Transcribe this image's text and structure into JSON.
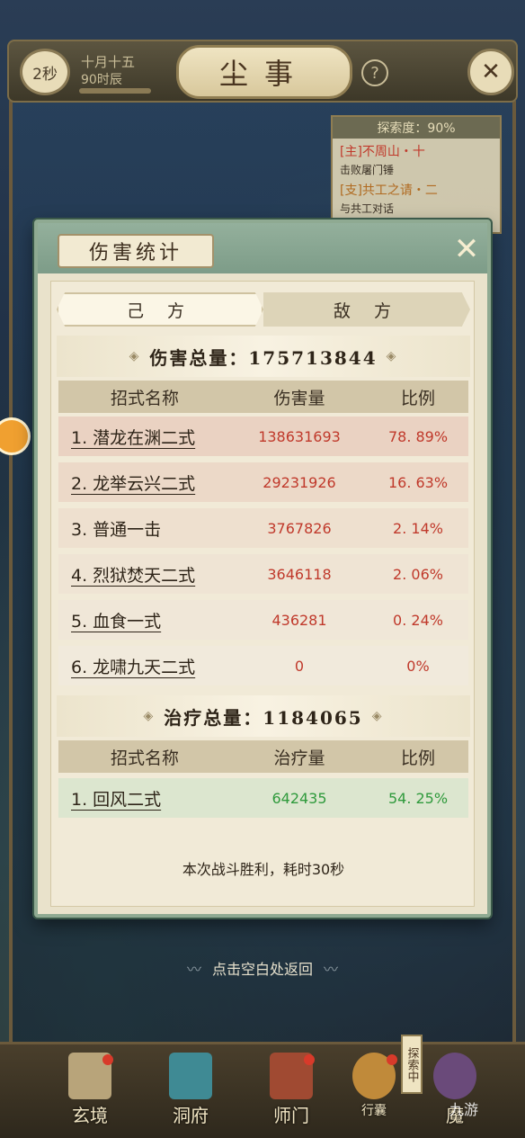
{
  "topbar": {
    "timer": "2秒",
    "date": "十月十五",
    "time_of_day": "90时辰",
    "title": "尘事",
    "help": "?",
    "map_icon": "crossed-swords-icon"
  },
  "quest": {
    "explore": "探索度：90%",
    "main_title": "[主]不周山・十",
    "main_desc": "击败屠门锤",
    "side_title": "[支]共工之请・二",
    "side_desc": "与共工对话"
  },
  "modal": {
    "title": "伤害统计",
    "tabs": [
      "己 方",
      "敌 方"
    ],
    "damage_total_label": "伤害总量：175713844",
    "damage_headers": [
      "招式名称",
      "伤害量",
      "比例"
    ],
    "damage_rows": [
      {
        "name": "1. 潜龙在渊二式",
        "value": "138631693",
        "pct": "78. 89%"
      },
      {
        "name": "2. 龙举云兴二式",
        "value": "29231926",
        "pct": "16. 63%"
      },
      {
        "name": "3. 普通一击",
        "value": "3767826",
        "pct": "2. 14%"
      },
      {
        "name": "4. 烈狱焚天二式",
        "value": "3646118",
        "pct": "2. 06%"
      },
      {
        "name": "5. 血食一式",
        "value": "436281",
        "pct": "0. 24%"
      },
      {
        "name": "6. 龙啸九天二式",
        "value": "0",
        "pct": "0%"
      }
    ],
    "heal_total_label": "治疗总量：1184065",
    "heal_headers": [
      "招式名称",
      "治疗量",
      "比例"
    ],
    "heal_rows": [
      {
        "name": "1. 回风二式",
        "value": "642435",
        "pct": "54. 25%"
      }
    ],
    "result": "本次战斗胜利，耗时30秒"
  },
  "return_hint": "点击空白处返回",
  "nav": {
    "items": [
      "玄境",
      "洞府",
      "师门",
      "行囊",
      "魔"
    ],
    "explore_badge": "探索中",
    "watermark": "九游"
  },
  "colors": {
    "damage": "#c0392b",
    "heal": "#2f9a3c",
    "modal_frame": "#8faa92"
  }
}
